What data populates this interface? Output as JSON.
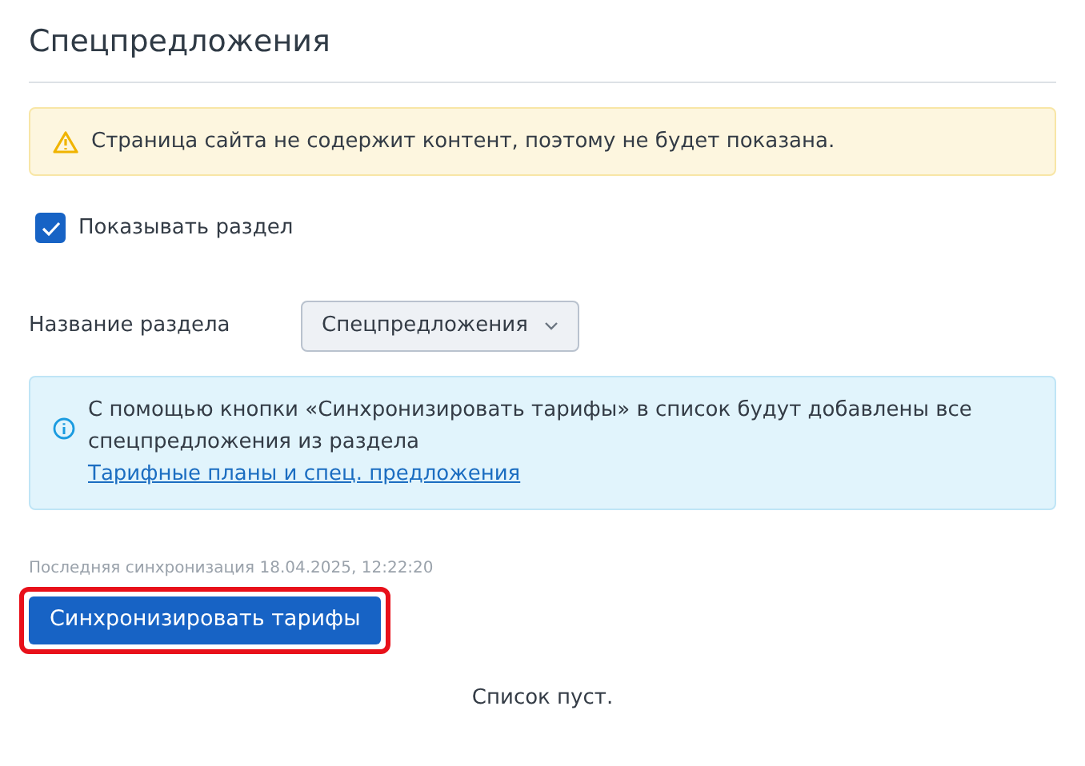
{
  "title": "Спецпредложения",
  "warning": {
    "text": "Страница сайта не содержит контент, поэтому не будет показана."
  },
  "show_section": {
    "label": "Показывать раздел",
    "checked": true
  },
  "section_name": {
    "label": "Название раздела",
    "value": "Спецпредложения"
  },
  "info": {
    "text": "С помощью кнопки «Синхронизировать тарифы» в список будут добавлены все спецпредложения из раздела",
    "link": "Тарифные планы и спец. предложения"
  },
  "last_sync": "Последняя синхронизация 18.04.2025, 12:22:20",
  "sync_button": {
    "label": "Синхронизировать тарифы",
    "highlighted": true
  },
  "empty_text": "Список пуст."
}
